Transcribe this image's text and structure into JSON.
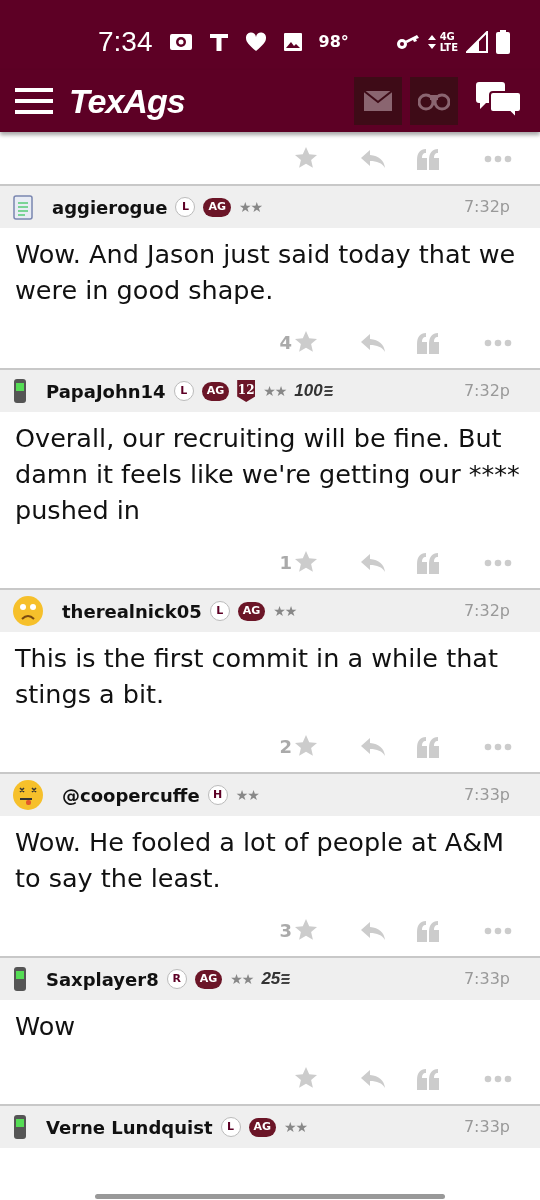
{
  "status_bar": {
    "time": "7:34",
    "temperature": "98°",
    "network_top": "4G",
    "network_bottom": "LTE"
  },
  "app_bar": {
    "logo": "TexAgs"
  },
  "posts": [
    {
      "kind": "footer"
    },
    {
      "kind": "full",
      "avatar": {
        "kind": "notepad"
      },
      "username": "aggierogue",
      "badges": [
        {
          "kind": "circle",
          "text": "L"
        },
        {
          "kind": "pill",
          "text": "AG"
        }
      ],
      "rank_stars": "★★",
      "time": "7:32p",
      "text": "Wow. And Jason just said today that we were in good shape.",
      "likes": "4"
    },
    {
      "kind": "full",
      "avatar": {
        "kind": "phone"
      },
      "username": "PapaJohn14",
      "badges": [
        {
          "kind": "circle",
          "text": "L"
        },
        {
          "kind": "pill",
          "text": "AG"
        },
        {
          "kind": "shield",
          "text": "12"
        }
      ],
      "rank_stars": "★★",
      "score": "100",
      "time": "7:32p",
      "text": "Overall, our recruiting will be fine. But damn it feels like we're getting our **** pushed in",
      "likes": "1"
    },
    {
      "kind": "full",
      "avatar": {
        "kind": "sad"
      },
      "username": "therealnick05",
      "badges": [
        {
          "kind": "circle",
          "text": "L"
        },
        {
          "kind": "pill",
          "text": "AG"
        }
      ],
      "rank_stars": "★★",
      "time": "7:32p",
      "text": "This is the first commit in a while that stings a bit.",
      "likes": "2"
    },
    {
      "kind": "full",
      "avatar": {
        "kind": "dizzy"
      },
      "username": "@coopercuffe",
      "badges": [
        {
          "kind": "circle",
          "text": "H"
        }
      ],
      "rank_stars": "★★",
      "time": "7:33p",
      "text": "Wow. He fooled a lot of people at A&M to say the least.",
      "likes": "3"
    },
    {
      "kind": "full",
      "avatar": {
        "kind": "phone"
      },
      "username": "Saxplayer8",
      "badges": [
        {
          "kind": "circle",
          "text": "R"
        },
        {
          "kind": "pill",
          "text": "AG"
        }
      ],
      "rank_stars": "★★",
      "score": "25",
      "time": "7:33p",
      "text": "Wow"
    },
    {
      "kind": "header",
      "avatar": {
        "kind": "phone"
      },
      "username": "Verne Lundquist",
      "badges": [
        {
          "kind": "circle",
          "text": "L"
        },
        {
          "kind": "pill",
          "text": "AG"
        }
      ],
      "rank_stars": "★★",
      "time": "7:33p"
    }
  ]
}
